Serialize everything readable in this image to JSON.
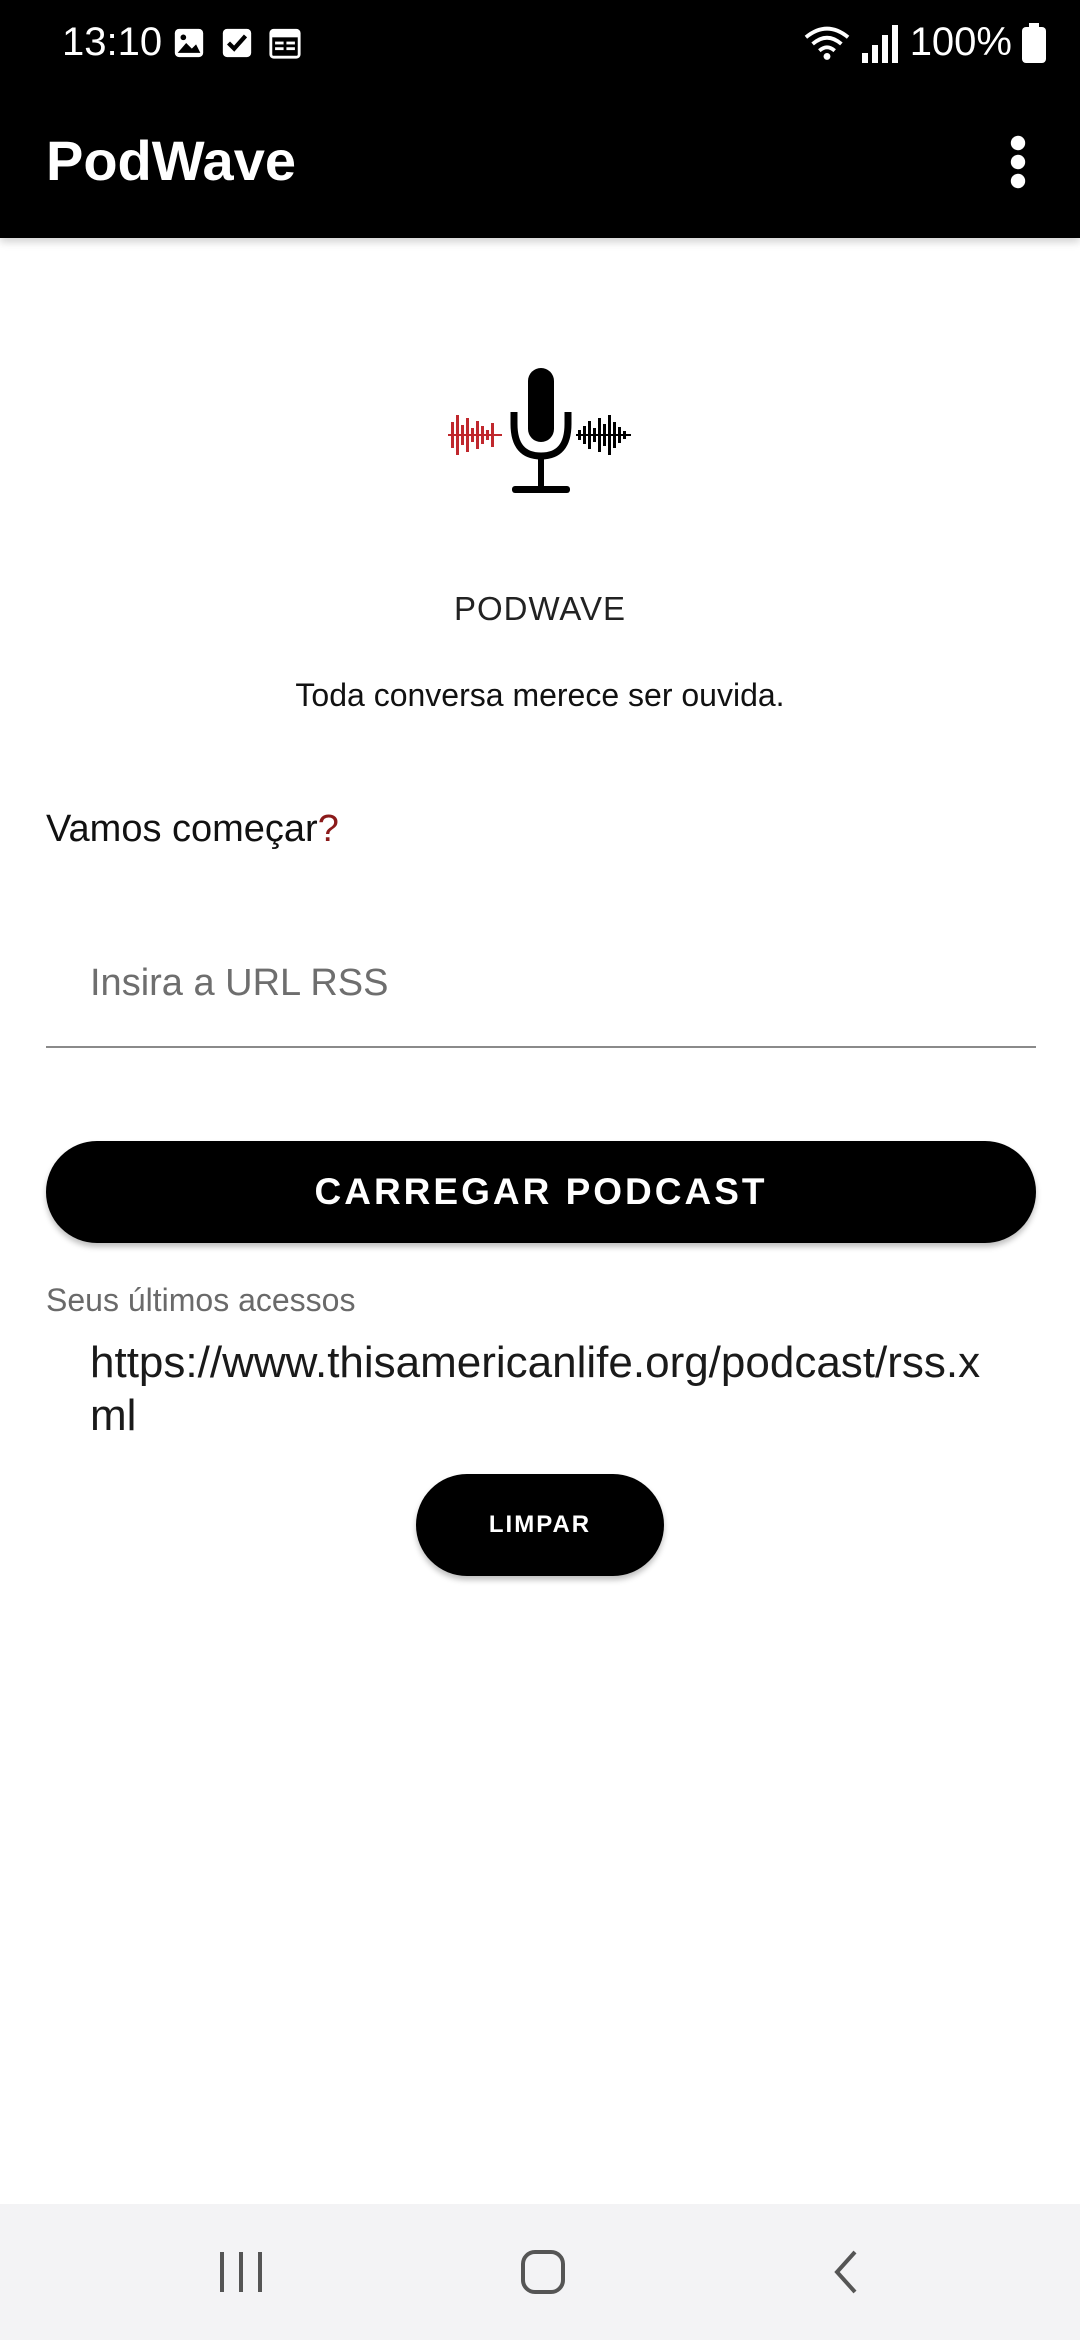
{
  "status_bar": {
    "time": "13:10",
    "left_icons": [
      "image-icon",
      "check-box-icon",
      "calendar-icon"
    ],
    "right_icons": [
      "wifi-icon",
      "signal-icon",
      "battery-icon"
    ],
    "battery": "100%"
  },
  "app_bar": {
    "title": "PodWave",
    "overflow_icon": "more-vert-icon"
  },
  "main": {
    "logo_icon": "microphone-waveform-icon",
    "brand": "PODWAVE",
    "tagline": "Toda conversa merece ser ouvida.",
    "prompt": "Vamos começar",
    "prompt_mark": "?",
    "url_placeholder": "Insira a URL RSS",
    "url_value": "",
    "load_button": "CARREGAR PODCAST",
    "recent_label": "Seus últimos acessos",
    "recent_items": [
      "https://www.thisamericanlife.org/podcast/rss.xml"
    ],
    "clear_button": "LIMPAR"
  },
  "colors": {
    "bar_background": "#000000",
    "accent": "#8b1a1a",
    "logo_wave_red": "#c0282d"
  },
  "nav_bar": {
    "buttons": [
      "recent-apps-icon",
      "home-icon",
      "back-icon"
    ]
  }
}
